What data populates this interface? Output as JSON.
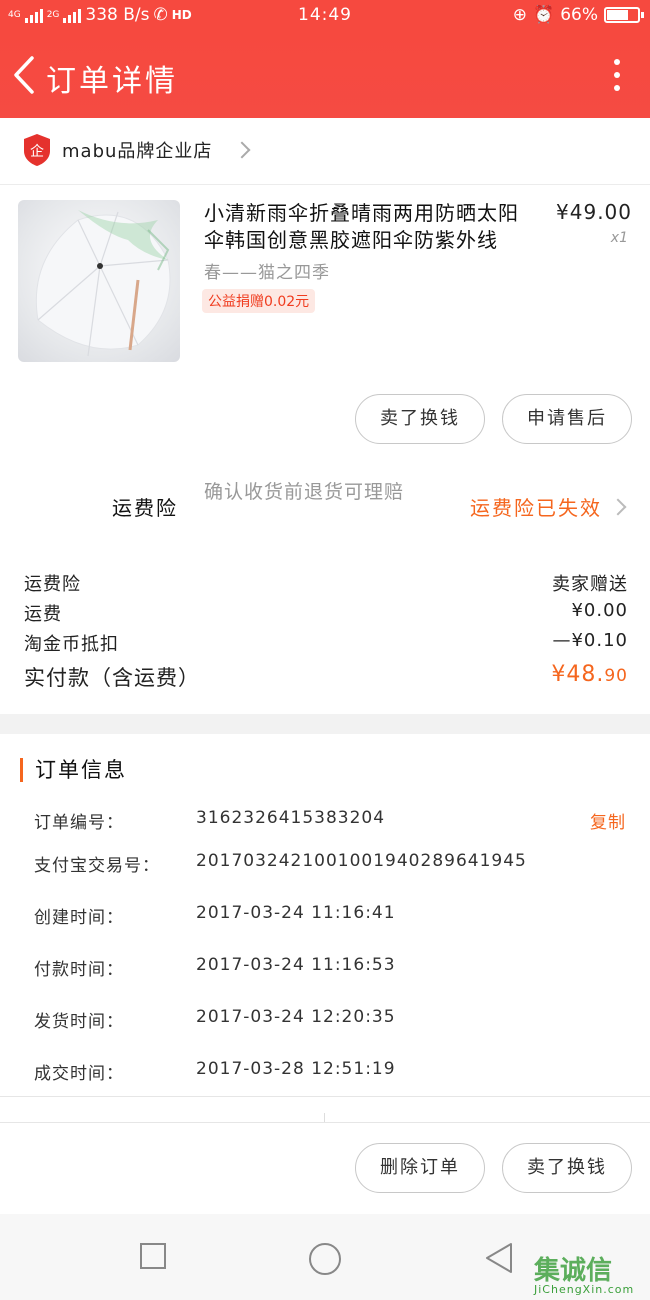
{
  "status_bar": {
    "network_1": "4G",
    "network_2": "2G",
    "speed": "338 B/s",
    "hd": "HD",
    "time": "14:49",
    "battery": "66%",
    "battery_level": 0.66
  },
  "header": {
    "title": "订单详情",
    "back_icon": "chevron-left-icon",
    "more_icon": "more-vertical-icon"
  },
  "shop": {
    "badge_text": "企",
    "name": "mabu品牌企业店"
  },
  "product": {
    "title": "小清新雨伞折叠晴雨两用防晒太阳伞韩国创意黑胶遮阳伞防紫外线",
    "price": "¥49.00",
    "quantity": "x1",
    "sku": "春——猫之四季",
    "charity_tag": "公益捐赠0.02元"
  },
  "item_actions": {
    "sell_label": "卖了换钱",
    "after_sale_label": "申请售后"
  },
  "insurance": {
    "label": "运费险",
    "description": "确认收货前退货可理赔",
    "status": "运费险已失效"
  },
  "fees": [
    {
      "label": "运费险",
      "value": "卖家赠送"
    },
    {
      "label": "运费",
      "value": "¥0.00"
    },
    {
      "label": "淘金币抵扣",
      "value": "—¥0.10"
    }
  ],
  "total": {
    "label": "实付款（含运费）",
    "value_main": "¥48.",
    "value_cents": "90"
  },
  "order_info": {
    "title": "订单信息",
    "copy_label": "复制",
    "rows": [
      {
        "label": "订单编号：",
        "value": "3162326415383204"
      },
      {
        "label": "支付宝交易号：",
        "value": "2017032421001001940289641945"
      },
      {
        "label": "创建时间：",
        "value": "2017-03-24  11:16:41"
      },
      {
        "label": "付款时间：",
        "value": "2017-03-24  11:16:53"
      },
      {
        "label": "发货时间：",
        "value": "2017-03-24  12:20:35"
      },
      {
        "label": "成交时间：",
        "value": "2017-03-28  12:51:19"
      }
    ]
  },
  "bottom_actions": {
    "delete_label": "删除订单",
    "sell_label": "卖了换钱"
  },
  "watermark": {
    "mark": "集诚信",
    "text": "JiChengXin.com"
  },
  "colors": {
    "header_red": "#f6493f",
    "accent_orange": "#f5661e",
    "charity_red": "#f03c1f"
  }
}
